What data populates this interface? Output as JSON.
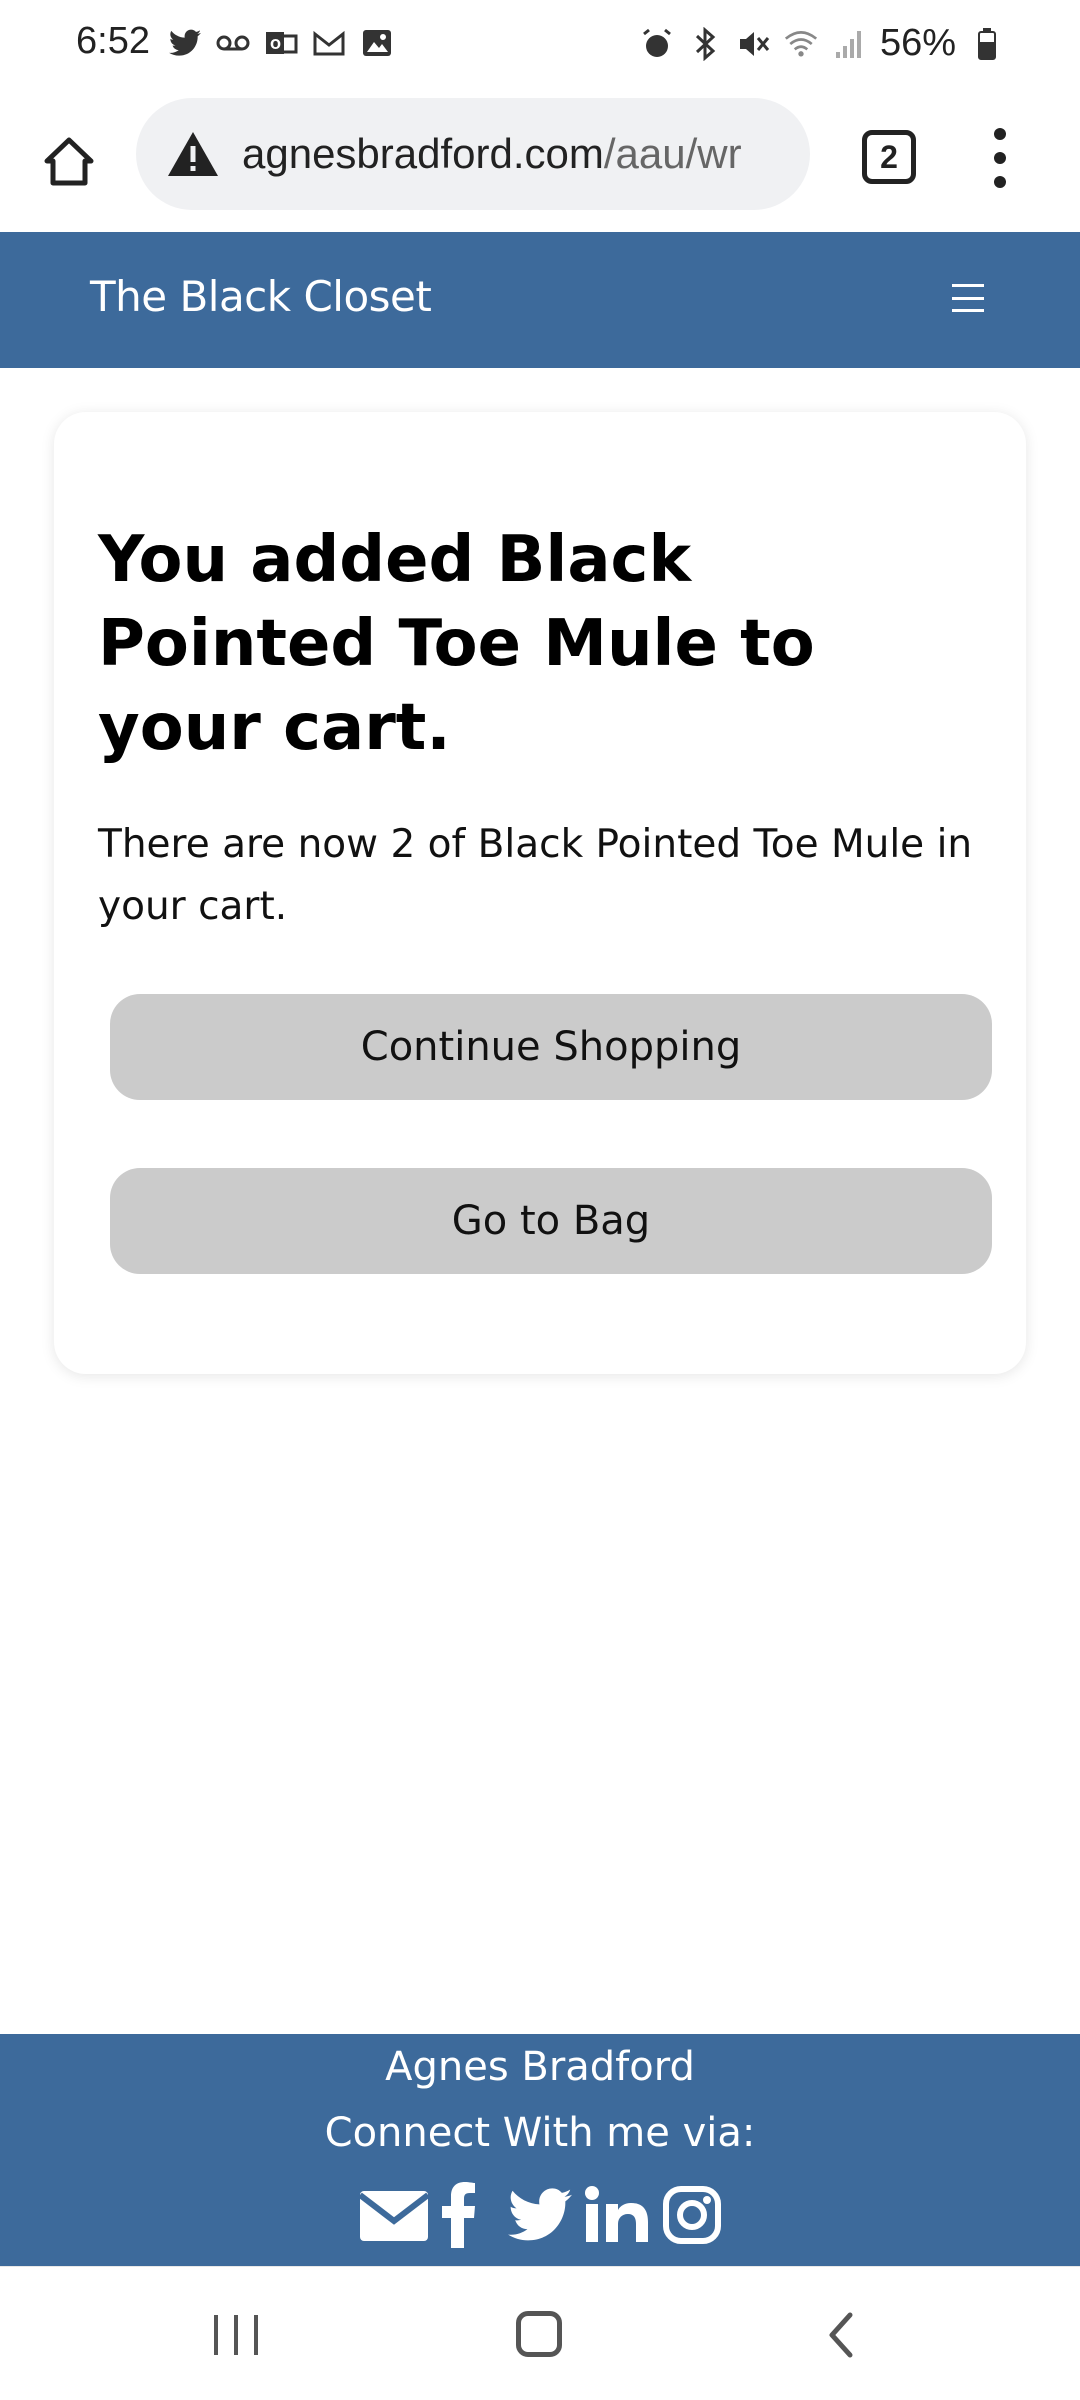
{
  "status_bar": {
    "time": "6:52",
    "left_icons": [
      "twitter-icon",
      "voicemail-icon",
      "outlook-icon",
      "gmail-icon",
      "gallery-icon"
    ],
    "right_icons": [
      "alarm-icon",
      "bluetooth-icon",
      "mute-icon",
      "wifi-icon",
      "signal-icon",
      "battery-icon"
    ],
    "battery": "56%"
  },
  "browser": {
    "url_host": "agnesbradford.com",
    "url_path": "/aau/wr",
    "tab_count": "2"
  },
  "site": {
    "brand": "The Black Closet"
  },
  "card": {
    "title": "You added Black Pointed Toe Mule to your cart.",
    "message": "There are now 2 of Black Pointed Toe Mule in your cart.",
    "continue_label": "Continue Shopping",
    "bag_label": "Go to Bag"
  },
  "footer": {
    "name": "Agnes Bradford",
    "connect": "Connect With me via:",
    "social_icons": [
      "email-icon",
      "facebook-icon",
      "twitter-icon",
      "linkedin-icon",
      "instagram-icon"
    ]
  },
  "colors": {
    "header_bg": "#3d6a9b",
    "button_bg": "#cbcbcb"
  }
}
